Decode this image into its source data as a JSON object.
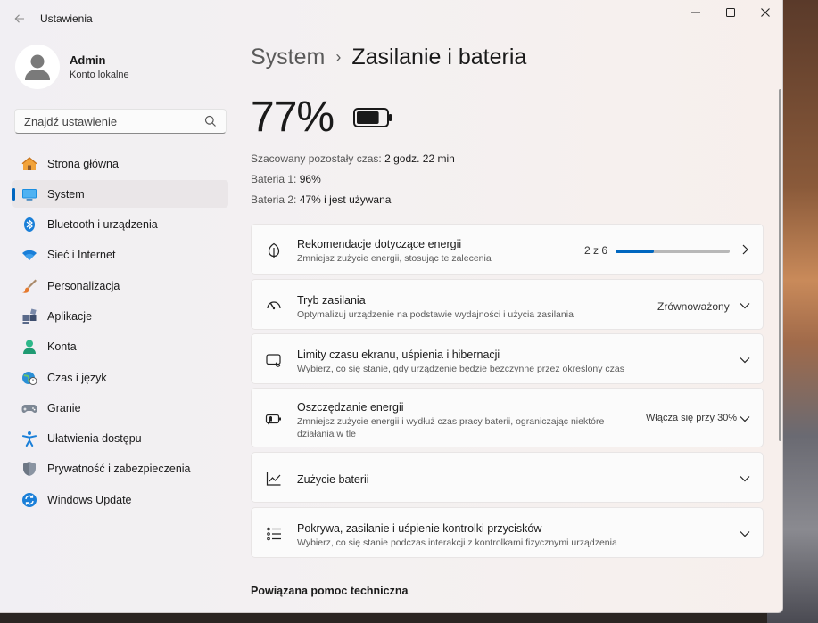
{
  "window": {
    "title": "Ustawienia",
    "back_icon": "arrow-left-icon",
    "minimize_icon": "minimize-icon",
    "maximize_icon": "maximize-icon",
    "close_icon": "close-icon"
  },
  "user": {
    "name": "Admin",
    "account_type": "Konto lokalne"
  },
  "search": {
    "placeholder": "Znajdź ustawienie"
  },
  "sidebar": {
    "items": [
      {
        "label": "Strona główna",
        "icon": "home-icon"
      },
      {
        "label": "System",
        "icon": "system-display-icon",
        "active": true
      },
      {
        "label": "Bluetooth i urządzenia",
        "icon": "bluetooth-icon"
      },
      {
        "label": "Sieć i Internet",
        "icon": "wifi-icon"
      },
      {
        "label": "Personalizacja",
        "icon": "brush-icon"
      },
      {
        "label": "Aplikacje",
        "icon": "apps-icon"
      },
      {
        "label": "Konta",
        "icon": "account-icon"
      },
      {
        "label": "Czas i język",
        "icon": "globe-clock-icon"
      },
      {
        "label": "Granie",
        "icon": "gamepad-icon"
      },
      {
        "label": "Ułatwienia dostępu",
        "icon": "accessibility-icon"
      },
      {
        "label": "Prywatność i zabezpieczenia",
        "icon": "shield-icon"
      },
      {
        "label": "Windows Update",
        "icon": "windows-update-icon"
      }
    ]
  },
  "breadcrumb": {
    "parent": "System",
    "separator": "›",
    "current": "Zasilanie i bateria"
  },
  "battery": {
    "percent_text": "77%",
    "percent": 77,
    "estimate_label": "Szacowany pozostały czas:",
    "estimate_value": "2 godz. 22 min",
    "battery1_label": "Bateria 1:",
    "battery1_value": "96%",
    "battery2_label": "Bateria 2:",
    "battery2_value": "47% i jest używana"
  },
  "cards": {
    "energy_recommendations": {
      "title": "Rekomendacje dotyczące energii",
      "subtitle": "Zmniejsz zużycie energii, stosując te zalecenia",
      "progress_text": "2 z 6",
      "progress_fraction": 0.333,
      "icon": "leaf-icon"
    },
    "power_mode": {
      "title": "Tryb zasilania",
      "subtitle": "Optymalizuj urządzenie na podstawie wydajności i użycia zasilania",
      "value": "Zrównoważony",
      "icon": "gauge-icon"
    },
    "screen_sleep": {
      "title": "Limity czasu ekranu, uśpienia i hibernacji",
      "subtitle": "Wybierz, co się stanie, gdy urządzenie będzie bezczynne przez określony czas",
      "icon": "screen-sleep-icon"
    },
    "energy_saver": {
      "title": "Oszczędzanie energii",
      "subtitle_line1": "Zmniejsz zużycie energii i wydłuż czas pracy baterii, ograniczając niektóre",
      "subtitle_line2": "działania w tle",
      "value": "Włącza się przy 30%",
      "icon": "battery-saver-icon"
    },
    "battery_usage": {
      "title": "Zużycie baterii",
      "icon": "chart-line-icon"
    },
    "lid_power_buttons": {
      "title": "Pokrywa, zasilanie i uśpienie kontrolki przycisków",
      "subtitle": "Wybierz, co się stanie podczas interakcji z kontrolkami fizycznymi urządzenia",
      "icon": "list-controls-icon"
    }
  },
  "related": {
    "heading": "Powiązana pomoc techniczna"
  },
  "colors": {
    "accent": "#0067c0",
    "window_bg": "#f3f0f0",
    "card_bg": "#fbfbfb"
  }
}
